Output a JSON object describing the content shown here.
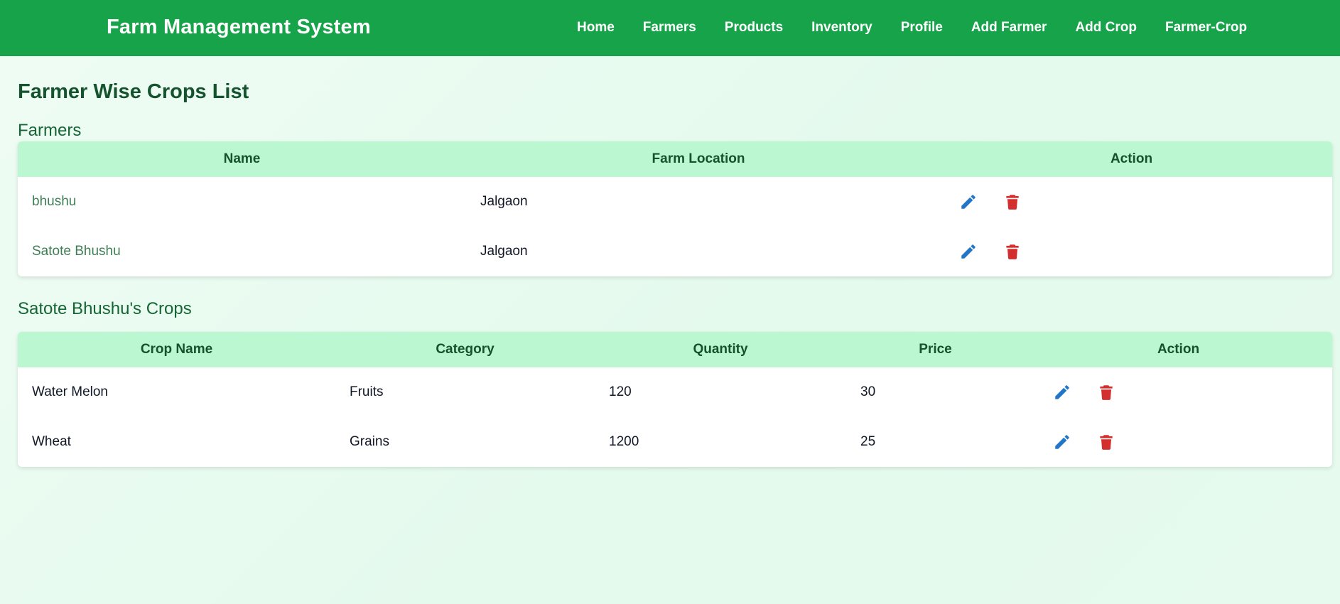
{
  "navbar": {
    "brand": "Farm Management System",
    "links": [
      "Home",
      "Farmers",
      "Products",
      "Inventory",
      "Profile",
      "Add Farmer",
      "Add Crop",
      "Farmer-Crop"
    ]
  },
  "page": {
    "title": "Farmer Wise Crops List"
  },
  "farmers": {
    "section_title": "Farmers",
    "columns": [
      "Name",
      "Farm Location",
      "Action"
    ],
    "rows": [
      {
        "name": "bhushu",
        "location": "Jalgaon"
      },
      {
        "name": "Satote Bhushu",
        "location": "Jalgaon"
      }
    ]
  },
  "crops": {
    "section_title": "Satote Bhushu's Crops",
    "columns": [
      "Crop Name",
      "Category",
      "Quantity",
      "Price",
      "Action"
    ],
    "rows": [
      {
        "crop_name": "Water Melon",
        "category": "Fruits",
        "quantity": "120",
        "price": "30"
      },
      {
        "crop_name": "Wheat",
        "category": "Grains",
        "quantity": "1200",
        "price": "25"
      }
    ]
  },
  "colors": {
    "navbar": "#16a34a",
    "table_header": "#bbf7d0",
    "edit_icon": "#2276c8",
    "delete_icon": "#d32f2f"
  },
  "icons": {
    "edit": "pencil-icon",
    "delete": "trash-icon"
  }
}
